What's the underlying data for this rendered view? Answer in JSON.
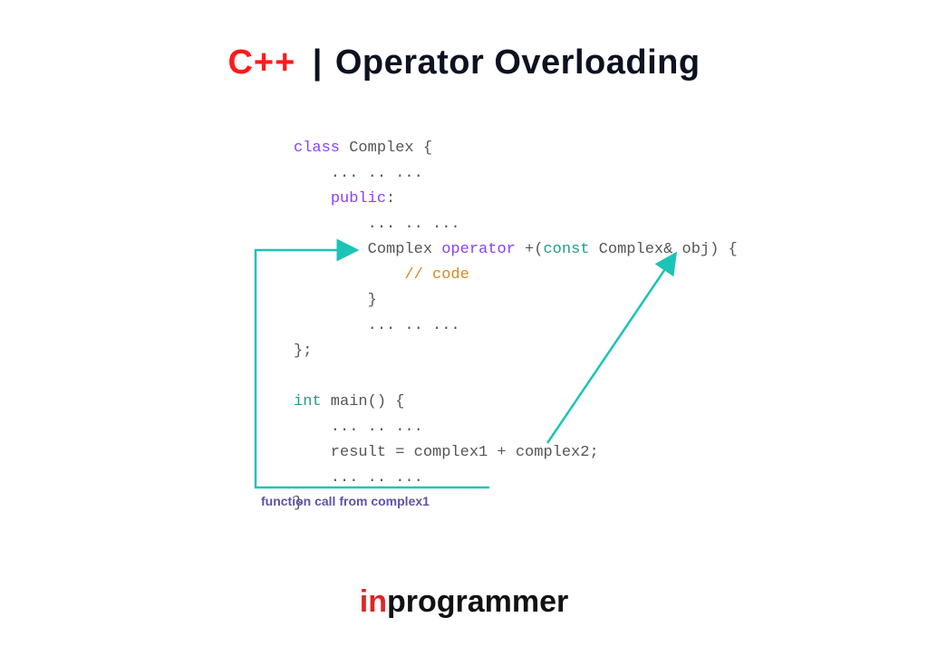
{
  "title": {
    "cpp": "C++",
    "bar": "|",
    "topic": "Operator Overloading"
  },
  "code": {
    "l1_kw": "class",
    "l1_rest": " Complex {",
    "l2": "    ... .. ...",
    "l3a": "    ",
    "l3_kw": "public",
    "l3b": ":",
    "l4": "        ... .. ...",
    "l5a": "        Complex ",
    "l5_kw": "operator",
    "l5b": " +(",
    "l5_const": "const",
    "l5c": " Complex& obj) {",
    "l6a": "            ",
    "l6_comment": "// code",
    "l7": "        }",
    "l8": "        ... .. ...",
    "l9": "};",
    "blank": "",
    "l10_kw": "int",
    "l10_rest": " main() {",
    "l11": "    ... .. ...",
    "l12": "    result = complex1 + complex2;",
    "l13": "    ... .. ...",
    "l14": "}"
  },
  "caption": "function call from complex1",
  "footer": {
    "in": "in",
    "rest": "programmer"
  },
  "colors": {
    "accent_teal": "#1bc4b5",
    "accent_red": "#ff1a1a",
    "caption_purple": "#5e53a6"
  }
}
